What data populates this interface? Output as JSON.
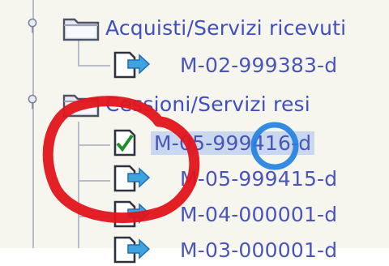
{
  "tree": {
    "folders": [
      {
        "label": "Acquisti/Servizi ricevuti",
        "icon": "folder-icon"
      },
      {
        "label": "Cessioni/Servizi resi",
        "icon": "folder-icon"
      }
    ],
    "items": [
      {
        "label": "M-02-999383-d",
        "icon": "document-arrow-icon",
        "state": "normal"
      },
      {
        "label": "M-05-999416-d",
        "icon": "document-checked-icon",
        "state": "selected"
      },
      {
        "label": "M-05-999415-d",
        "icon": "document-arrow-icon",
        "state": "normal"
      },
      {
        "label": "M-04-000001-d",
        "icon": "document-arrow-icon",
        "state": "normal"
      },
      {
        "label": "M-03-000001-d",
        "icon": "document-arrow-icon",
        "state": "normal"
      }
    ]
  },
  "annotations": {
    "circle_color": "#e3141b",
    "cursor_color": "#1f7fe0"
  }
}
